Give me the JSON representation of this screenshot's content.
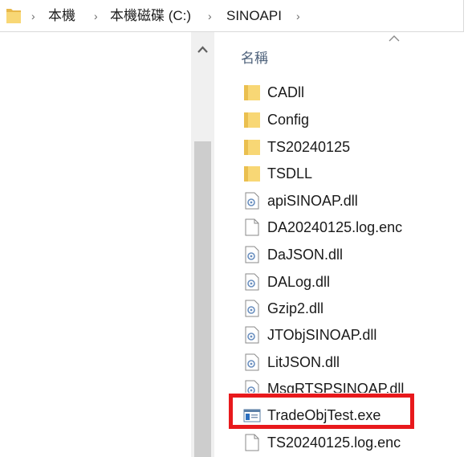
{
  "breadcrumb": {
    "items": [
      "本機",
      "本機磁碟 (C:)",
      "SINOAPI"
    ],
    "separator": "›"
  },
  "column": {
    "name_header": "名稱"
  },
  "files": [
    {
      "name": "CADll",
      "type": "folder"
    },
    {
      "name": "Config",
      "type": "folder"
    },
    {
      "name": "TS20240125",
      "type": "folder"
    },
    {
      "name": "TSDLL",
      "type": "folder"
    },
    {
      "name": "apiSINOAP.dll",
      "type": "dll"
    },
    {
      "name": "DA20240125.log.enc",
      "type": "file"
    },
    {
      "name": "DaJSON.dll",
      "type": "dll"
    },
    {
      "name": "DALog.dll",
      "type": "dll"
    },
    {
      "name": "Gzip2.dll",
      "type": "dll"
    },
    {
      "name": "JTObjSINOAP.dll",
      "type": "dll"
    },
    {
      "name": "LitJSON.dll",
      "type": "dll"
    },
    {
      "name": "MsgRTSPSINOAP.dll",
      "type": "dll"
    },
    {
      "name": "TradeObjTest.exe",
      "type": "exe"
    },
    {
      "name": "TS20240125.log.enc",
      "type": "file"
    }
  ],
  "colors": {
    "folder": "#f8d775",
    "highlight": "#e8191c",
    "header_text": "#4c607a"
  },
  "highlighted_file": "TradeObjTest.exe"
}
